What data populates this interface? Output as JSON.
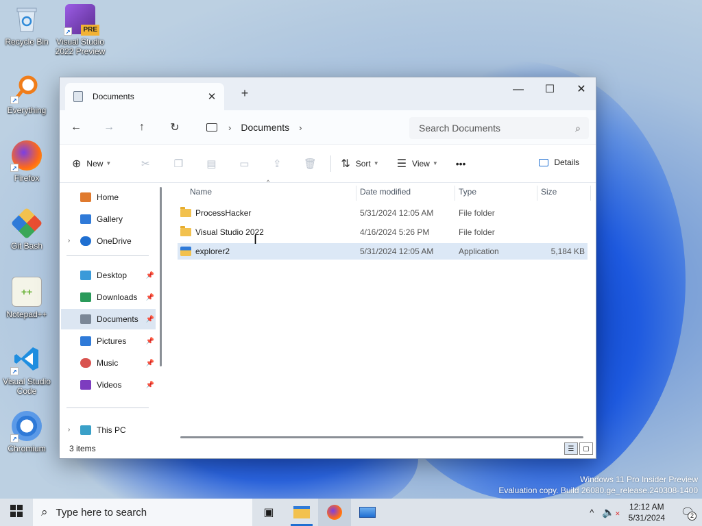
{
  "desktop": {
    "icons": [
      {
        "label": "Recycle Bin",
        "icon": "recycle-bin-icon"
      },
      {
        "label": "Visual Studio 2022 Preview",
        "badge": "PRE",
        "icon": "visual-studio-icon"
      },
      {
        "label": "Everything",
        "icon": "everything-search-icon"
      },
      {
        "label": "Firefox",
        "icon": "firefox-icon"
      },
      {
        "label": "Git Bash",
        "icon": "git-bash-icon"
      },
      {
        "label": "Notepad++",
        "icon": "notepadpp-icon"
      },
      {
        "label": "Visual Studio Code",
        "icon": "vscode-icon"
      },
      {
        "label": "Chromium",
        "icon": "chromium-icon"
      }
    ],
    "watermark": {
      "line1": "Windows 11 Pro Insider Preview",
      "line2": "Evaluation copy. Build 26080.ge_release.240308-1400"
    }
  },
  "explorer": {
    "tab": {
      "title": "Documents",
      "close": "✕"
    },
    "new_tab": "+",
    "window_controls": {
      "minimize": "—",
      "maximize": "☐",
      "close": "✕"
    },
    "address": {
      "segment": "Documents"
    },
    "search": {
      "placeholder": "Search Documents"
    },
    "toolbar": {
      "new_label": "New",
      "sort_label": "Sort",
      "view_label": "View",
      "more_label": "•••",
      "details_label": "Details"
    },
    "sidebar": {
      "items": [
        {
          "label": "Home",
          "icon": "home-icon",
          "color": "#e07a2e"
        },
        {
          "label": "Gallery",
          "icon": "gallery-icon",
          "color": "#2f7ad8"
        },
        {
          "label": "OneDrive",
          "icon": "onedrive-icon",
          "color": "#1f6fd1"
        },
        {
          "label": "Desktop",
          "icon": "desktop-icon",
          "color": "#3a9ad9"
        },
        {
          "label": "Downloads",
          "icon": "downloads-icon",
          "color": "#2a9a5a"
        },
        {
          "label": "Documents",
          "icon": "documents-icon",
          "color": "#7b8796"
        },
        {
          "label": "Pictures",
          "icon": "pictures-icon",
          "color": "#2f7ad8"
        },
        {
          "label": "Music",
          "icon": "music-icon",
          "color": "#d9534f"
        },
        {
          "label": "Videos",
          "icon": "videos-icon",
          "color": "#7d3cbf"
        },
        {
          "label": "This PC",
          "icon": "this-pc-icon",
          "color": "#3aa0c8"
        }
      ]
    },
    "columns": {
      "name": "Name",
      "date": "Date modified",
      "type": "Type",
      "size": "Size"
    },
    "files": [
      {
        "name": "ProcessHacker",
        "date": "5/31/2024 12:05 AM",
        "type": "File folder",
        "size": "",
        "icon": "folder-icon"
      },
      {
        "name": "Visual Studio 2022",
        "date": "4/16/2024 5:26 PM",
        "type": "File folder",
        "size": "",
        "icon": "folder-icon"
      },
      {
        "name": "explorer2",
        "date": "5/31/2024 12:05 AM",
        "type": "Application",
        "size": "5,184 KB",
        "icon": "application-icon"
      }
    ],
    "status": {
      "item_count": "3 items"
    }
  },
  "taskbar": {
    "search_placeholder": "Type here to search",
    "clock": {
      "time": "12:12 AM",
      "date": "5/31/2024"
    },
    "notification_count": "2"
  },
  "colors": {
    "accent": "#1f6fd1",
    "selection": "#dce8f6"
  }
}
